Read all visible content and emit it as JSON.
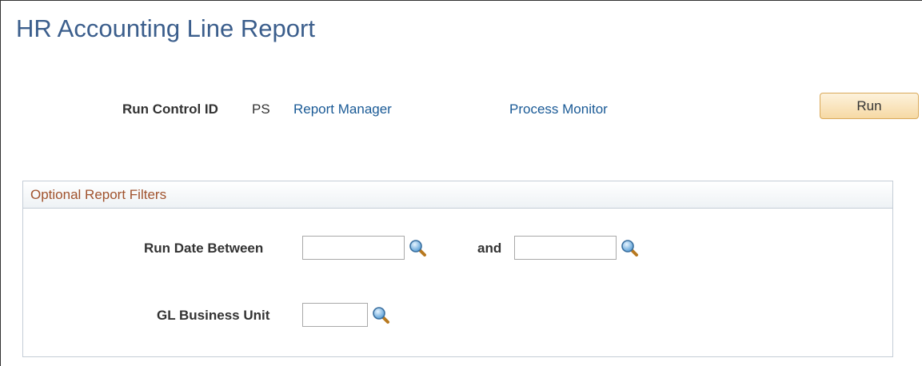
{
  "page": {
    "title": "HR Accounting Line Report"
  },
  "run_control": {
    "label": "Run Control ID",
    "value": "PS",
    "report_manager_link": "Report Manager",
    "process_monitor_link": "Process Monitor",
    "run_button": "Run"
  },
  "filters": {
    "header": "Optional Report Filters",
    "run_date_between_label": "Run Date Between",
    "run_date_from": "",
    "and_label": "and",
    "run_date_to": "",
    "gl_business_unit_label": "GL Business Unit",
    "gl_business_unit": ""
  },
  "icons": {
    "lookup": "magnifying-glass-icon"
  },
  "colors": {
    "title": "#3b5e8c",
    "link": "#1a5a96",
    "group_header_text": "#a0522d",
    "button_bg": "#f6d9a4"
  }
}
